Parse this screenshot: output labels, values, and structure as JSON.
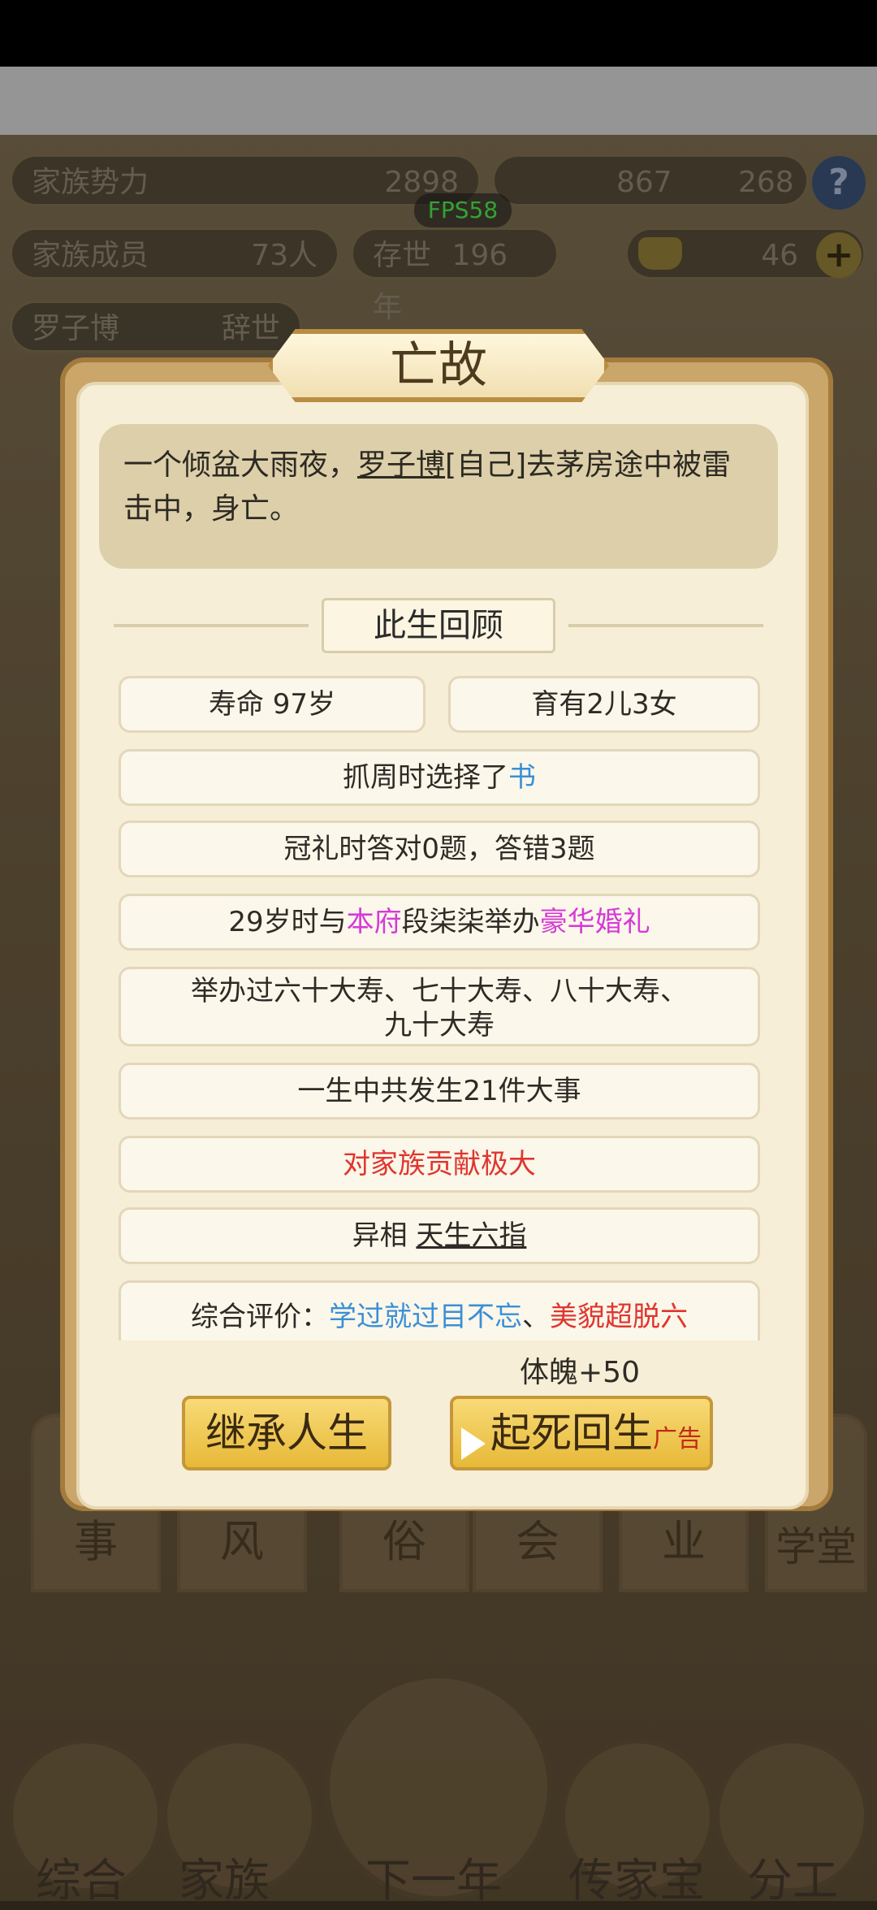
{
  "hud": {
    "family_power_label": "家族势力",
    "family_power_value": "2898",
    "currency_1": "867",
    "currency_2": "268",
    "family_members_label": "家族成员",
    "family_members_value": "73人",
    "lasting_label": "存世",
    "lasting_value": "196年",
    "gold_value": "46",
    "fps": "FPS58",
    "person_name": "罗子博",
    "person_status": "辞世"
  },
  "modal": {
    "title": "亡故",
    "event": {
      "pre": "一个倾盆大雨夜，",
      "name": "罗子博",
      "post": "[自己]去茅房途中被雷击中，身亡。"
    },
    "section_title": "此生回顾",
    "lifespan": "寿命 97岁",
    "children": "育有2儿3女",
    "zhuazhou_pre": "抓周时选择了",
    "zhuazhou_item": "书",
    "guanli": "冠礼时答对0题，答错3题",
    "wedding_pre": "29岁时与",
    "wedding_place": "本府",
    "wedding_mid": "段柒柒举办",
    "wedding_type": "豪华婚礼",
    "birthdays_line1": "举办过六十大寿、七十大寿、八十大寿、",
    "birthdays_line2": "九十大寿",
    "events": "一生中共发生21件大事",
    "contribution": "对家族贡献极大",
    "trait_label": "异相",
    "trait_value": "天生六指",
    "eval_label": "综合评价：",
    "eval_1": "学过就过目不忘",
    "eval_sep": "、",
    "eval_2": "美貌超脱六",
    "buff": "体魄+50",
    "inherit_button": "继承人生",
    "revive_button": "起死回生",
    "revive_ad": "广告"
  },
  "category_tabs": [
    "事",
    "风",
    "俗",
    "会",
    "业",
    "学堂"
  ],
  "bottom_nav": [
    "综合",
    "家族",
    "下一年",
    "传家宝",
    "分工"
  ]
}
